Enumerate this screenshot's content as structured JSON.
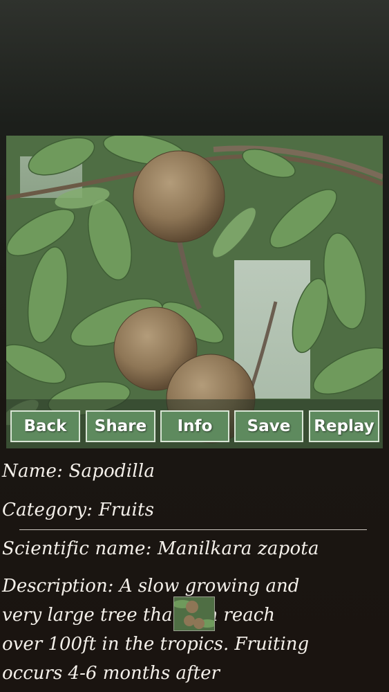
{
  "toolbar": {
    "buttons": [
      {
        "id": "back",
        "label": "Back"
      },
      {
        "id": "share",
        "label": "Share"
      },
      {
        "id": "info",
        "label": "Info"
      },
      {
        "id": "save",
        "label": "Save"
      },
      {
        "id": "replay",
        "label": "Replay"
      }
    ]
  },
  "details": {
    "name": "Name: Sapodilla",
    "category": "Category: Fruits",
    "scientific": "Scientific name: Manilkara zapota",
    "description_lines": [
      "Description: A slow growing and",
      "very large tree that can reach",
      "over 100ft in the tropics. Fruiting",
      "occurs 4-6 months after"
    ]
  },
  "colors": {
    "button_fill": "#5e8a5e",
    "button_border": "#d9e6d6",
    "text": "#f4f0ea"
  }
}
